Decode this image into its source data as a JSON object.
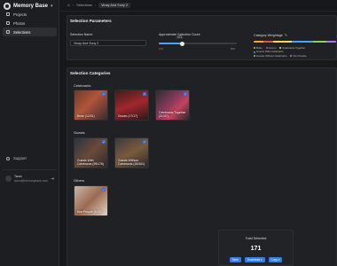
{
  "app": {
    "name": "Memory Base"
  },
  "sidebar": {
    "items": [
      {
        "label": "Projects",
        "icon": "folder-icon"
      },
      {
        "label": "Photos",
        "icon": "image-icon"
      },
      {
        "label": "Selections",
        "icon": "selection-icon",
        "active": true
      }
    ],
    "support_label": "Support",
    "user": {
      "name": "Tarun",
      "email": "tarun@memorybase.com"
    }
  },
  "breadcrumb": {
    "items": [
      "Selections",
      "Vinay And Sony 2"
    ]
  },
  "params": {
    "title": "Selection Parameters",
    "name_label": "Selection Name",
    "name_value": "Vinay And Sony 2",
    "count_label": "Approximate Selection Count",
    "count_value": "171",
    "count_min": "100",
    "count_max": "800",
    "weightage_label": "Category Weightage",
    "weightage": [
      {
        "name": "Bride",
        "color": "#f5a623"
      },
      {
        "name": "Groom",
        "color": "#e84a5f"
      },
      {
        "name": "Celebrants Together",
        "color": "#f7e04b"
      },
      {
        "name": "Guests With Celebrants",
        "color": "#4aa3ff"
      },
      {
        "name": "Guests Without Celebrants",
        "color": "#8ecf6a"
      },
      {
        "name": "Non People",
        "color": "#b76ef0"
      }
    ]
  },
  "categories": {
    "title": "Selection Categories",
    "sections": [
      {
        "title": "Celebrants",
        "cards": [
          "Bride (12/31)",
          "Groom (17/17)",
          "Celebrants Together (31/37)"
        ]
      },
      {
        "title": "Guests",
        "cards": [
          "Guests With Celebrants (99/176)",
          "Guests Without Celebrants (18/361)"
        ]
      },
      {
        "title": "Others",
        "cards": [
          "Non People (6/25)"
        ]
      }
    ]
  },
  "summary": {
    "label": "Total Selected",
    "count": "171",
    "buttons": [
      "Save",
      "Download",
      "Copy"
    ]
  }
}
